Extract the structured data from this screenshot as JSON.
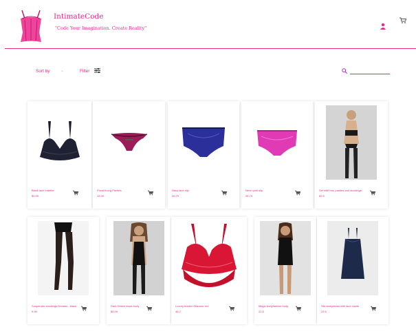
{
  "header": {
    "brand": "IntimateCode",
    "tagline": "\"Code Your Imagination. Create Reality\"",
    "user_icon": "user-icon",
    "cart_icon": "cart-icon"
  },
  "toolbar": {
    "sort_label": "Sort by",
    "filter_label": "Filter",
    "search_placeholder": ""
  },
  "colors": {
    "accent": "#e8298c",
    "bg": "#ffffff"
  },
  "products": [
    {
      "name": "Black lace bralette",
      "price": "$9.99"
    },
    {
      "name": "Floral thong Panties",
      "price": "13.99"
    },
    {
      "name": "Navy lace slip",
      "price": "26.79"
    },
    {
      "name": "Neon pink slip",
      "price": "26.79"
    },
    {
      "name": "Set with bra, panties and stockings",
      "price": "60.5"
    },
    {
      "name": "Suspender stockings Dreams - black",
      "price": "9.99"
    },
    {
      "name": "Dark Desire black body",
      "price": "$9.99"
    },
    {
      "name": "Luxury bustier Glamour red",
      "price": "46.2"
    },
    {
      "name": "Magic bodyfashion body",
      "price": "22.5"
    },
    {
      "name": "Silk sleepdress with lace insets",
      "price": "22.5"
    }
  ]
}
